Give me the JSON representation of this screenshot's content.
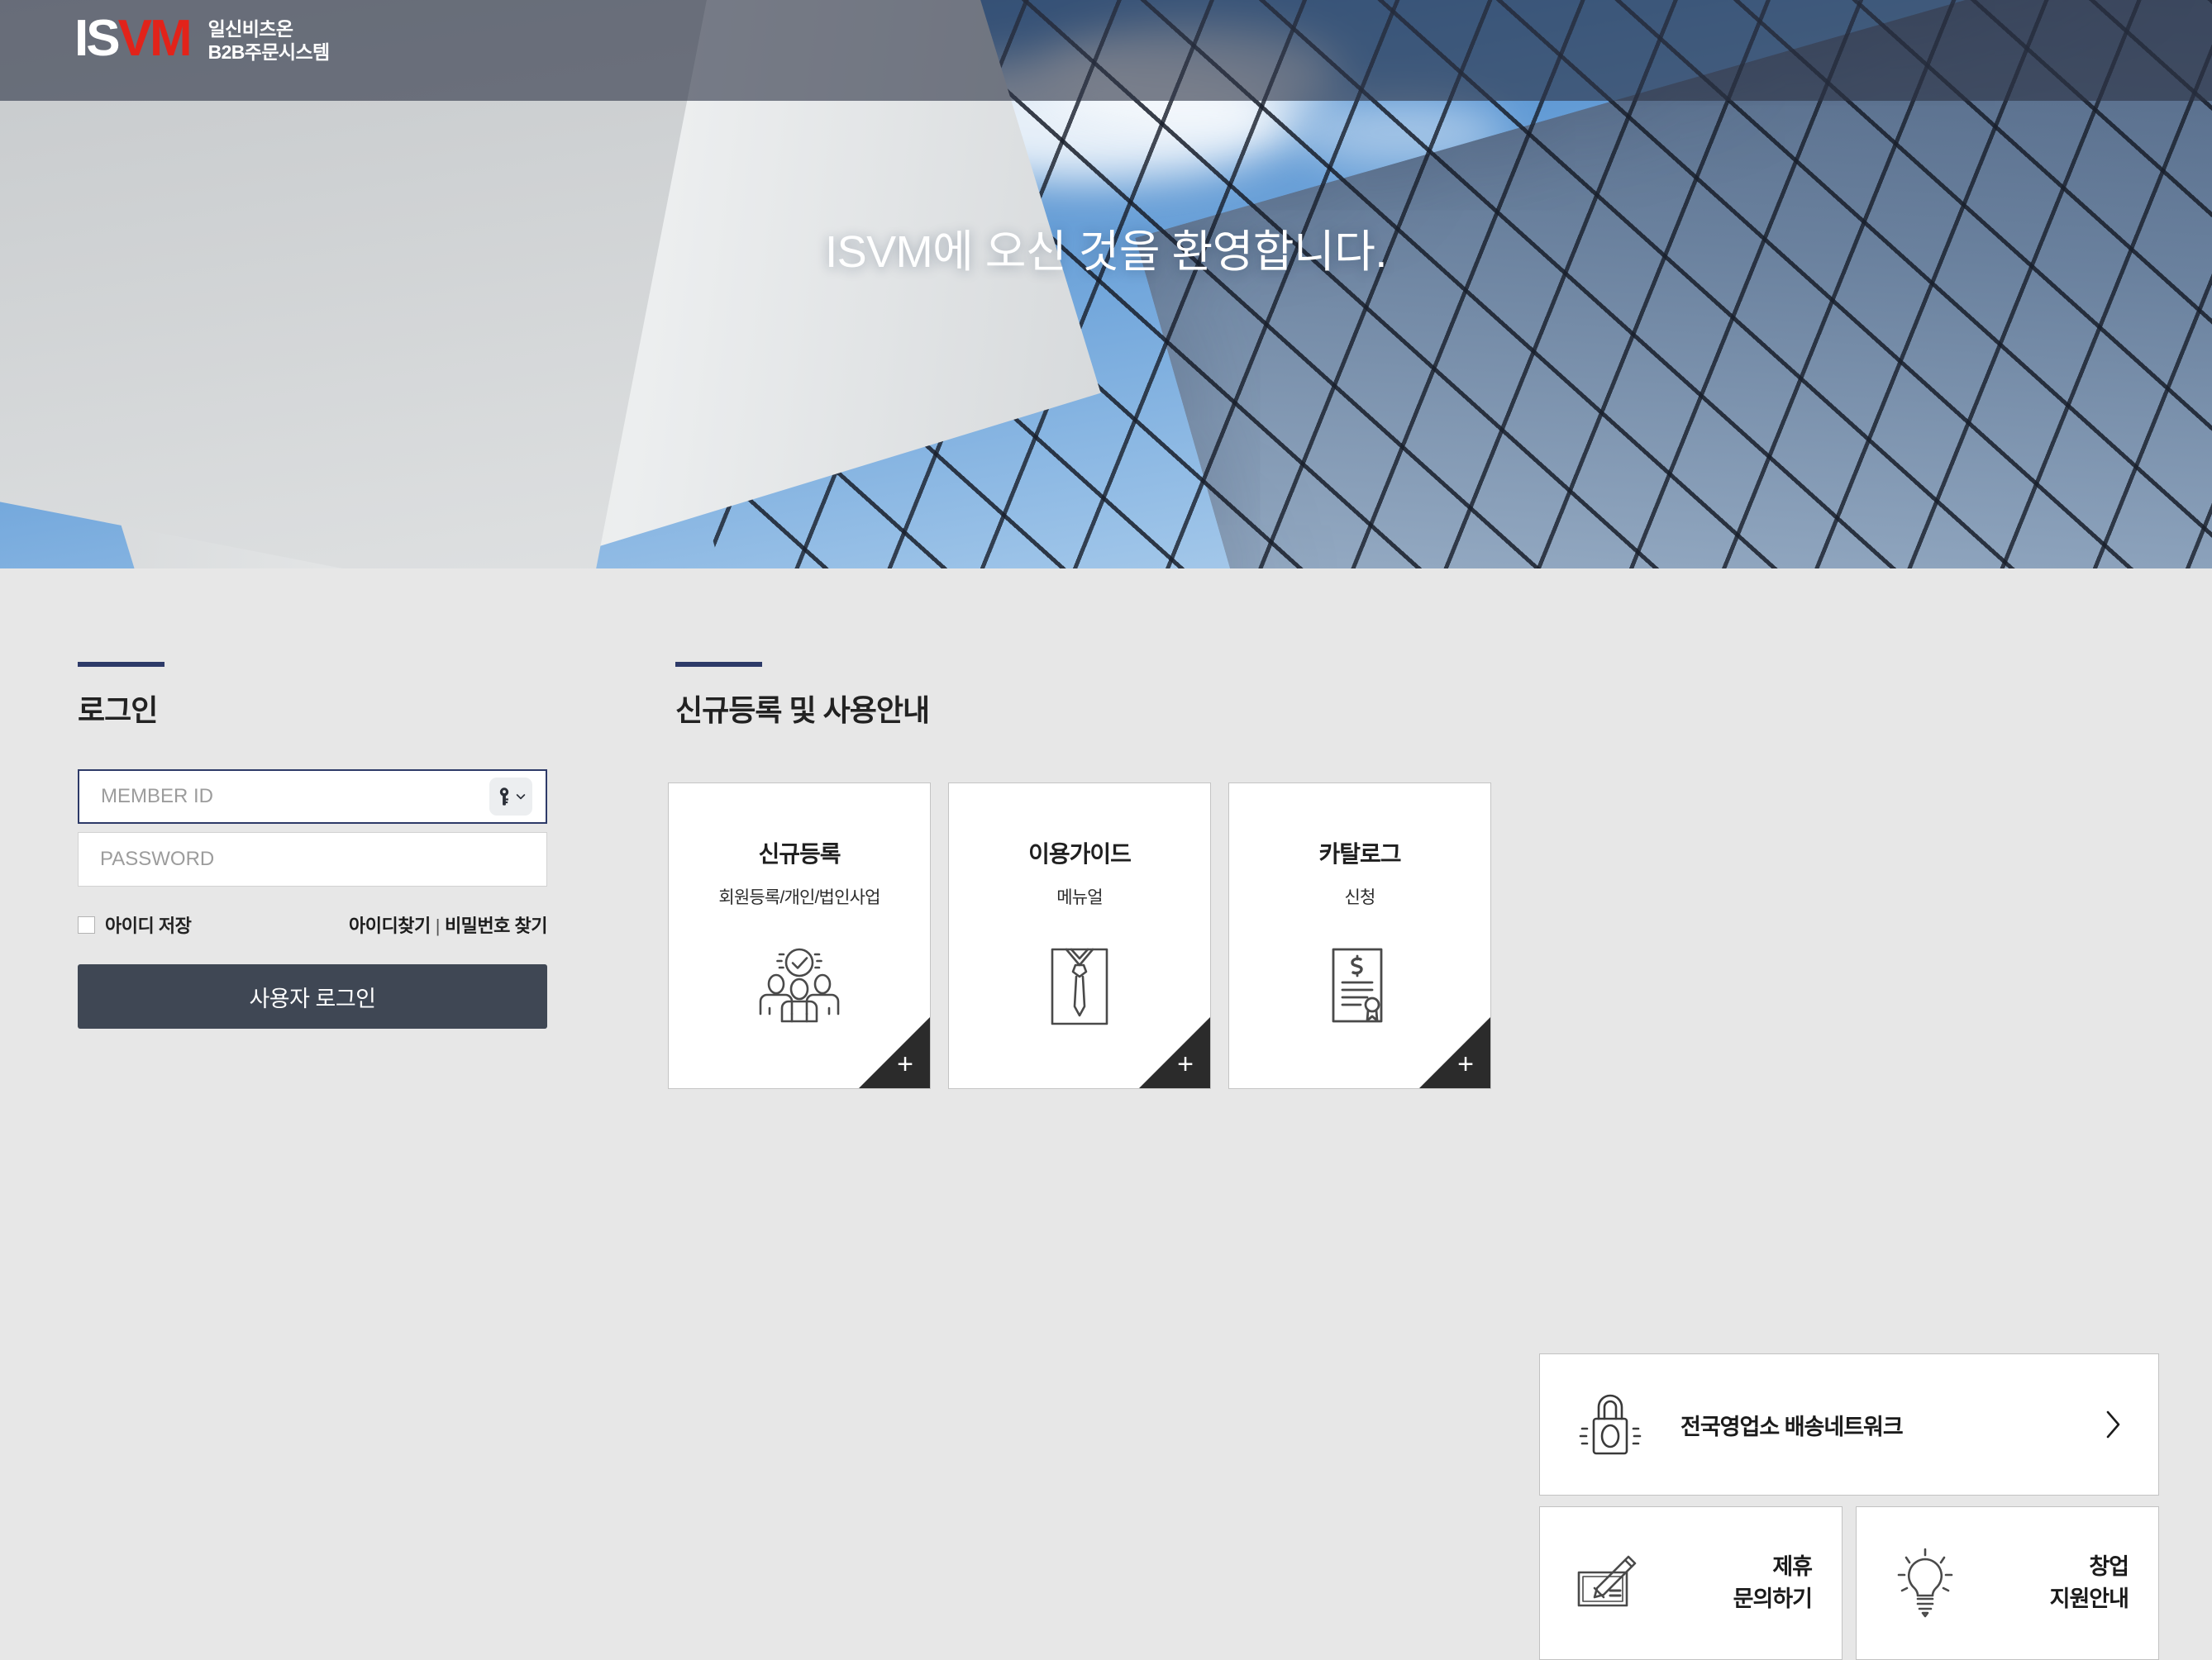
{
  "header": {
    "logo_primary": "IS",
    "logo_secondary": "VM",
    "logo_sub_line1": "일신비츠온",
    "logo_sub_line2": "B2B주문시스템",
    "logo_color_primary": "#ffffff",
    "logo_color_secondary": "#e2231a"
  },
  "hero": {
    "title": "ISVM에 오신 것을 환영합니다."
  },
  "login": {
    "section_title": "로그인",
    "accent_color": "#2d3a68",
    "member_id_placeholder": "MEMBER ID",
    "member_id_value": "",
    "password_placeholder": "PASSWORD",
    "password_value": "",
    "key_icon": "key-icon",
    "remember_label": "아이디 저장",
    "remember_checked": false,
    "find_id_label": "아이디찾기",
    "separator": "|",
    "find_pw_label": "비밀번호 찾기",
    "submit_label": "사용자 로그인",
    "submit_color": "#3f4754"
  },
  "guide": {
    "section_title": "신규등록 및 사용안내",
    "accent_color": "#2d3a68",
    "corner_plus": "+",
    "cards": [
      {
        "title": "신규등록",
        "subtitle": "회원등록/개인/법인사업",
        "icon": "people-check-icon"
      },
      {
        "title": "이용가이드",
        "subtitle": "메뉴얼",
        "icon": "shirt-tie-icon"
      },
      {
        "title": "카탈로그",
        "subtitle": "신청",
        "icon": "certificate-icon"
      }
    ]
  },
  "panels": {
    "wide": {
      "label": "전국영업소 배송네트워크",
      "icon": "lock-icon",
      "arrow": "chevron-right-icon"
    },
    "small": [
      {
        "line1": "제휴",
        "line2": "문의하기",
        "icon": "pen-write-icon"
      },
      {
        "line1": "창업",
        "line2": "지원안내",
        "icon": "lightbulb-icon"
      }
    ]
  }
}
